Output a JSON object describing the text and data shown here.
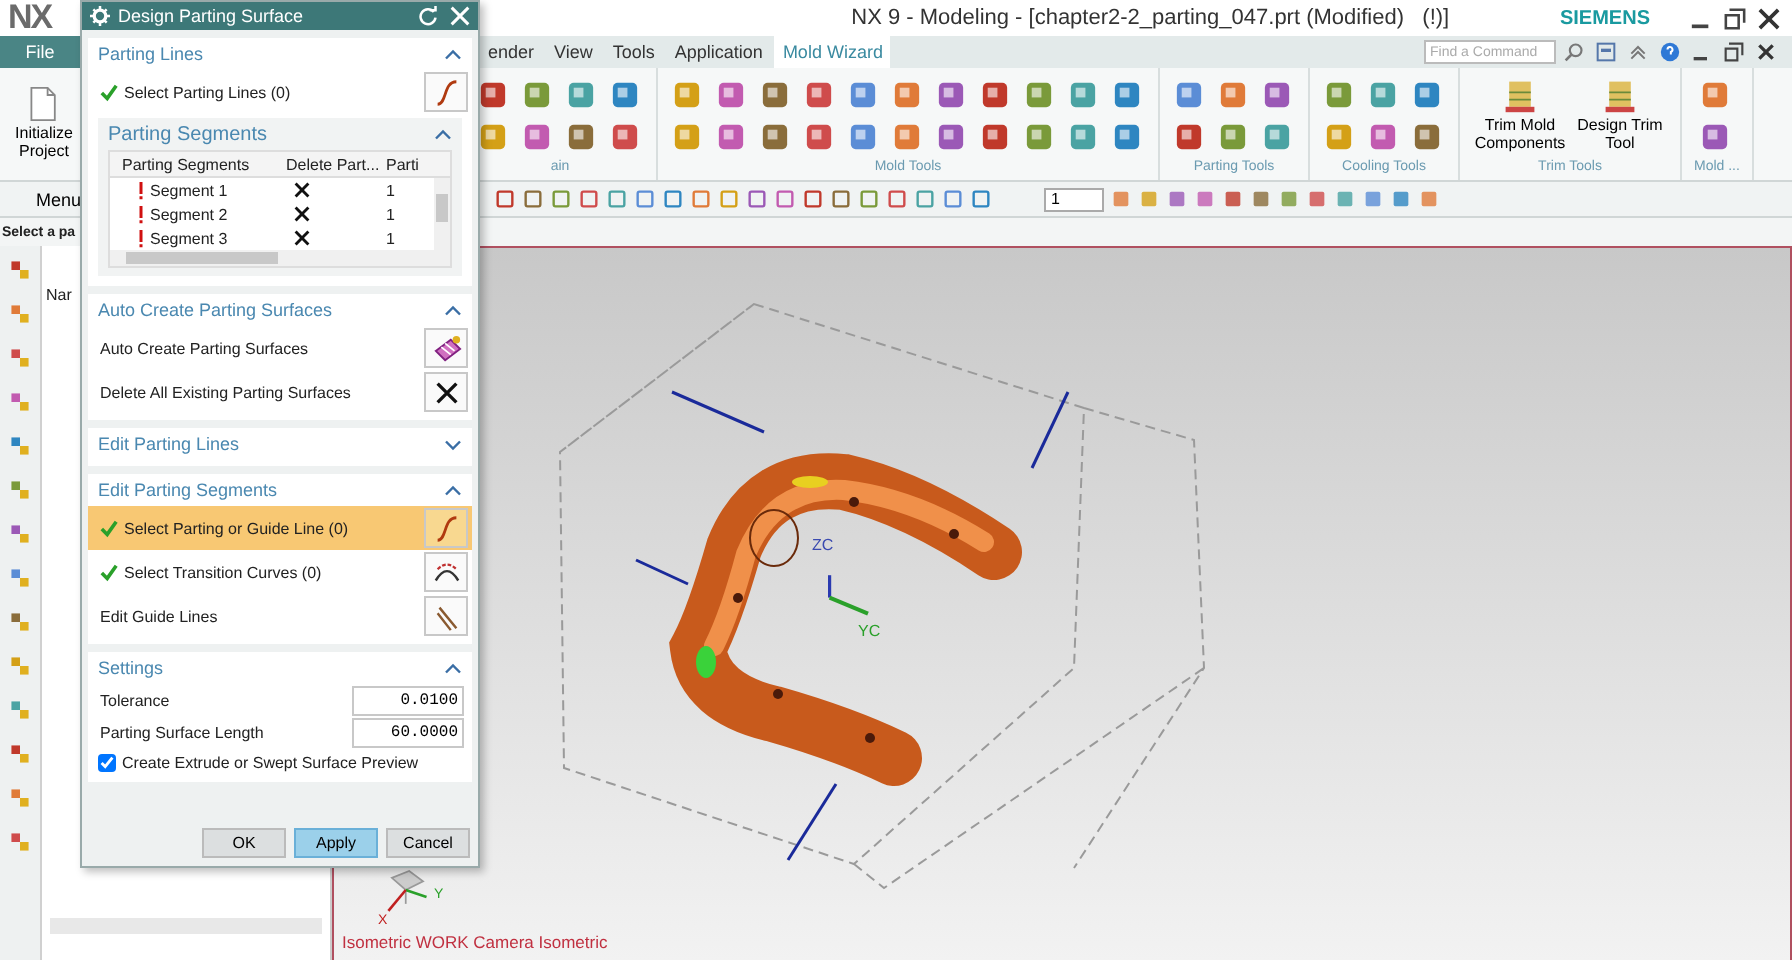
{
  "window": {
    "logo": "NX",
    "title": "NX 9 - Modeling - [chapter2-2_parting_047.prt (Modified)   (!)]",
    "brand": "SIEMENS"
  },
  "menu_tabs": [
    {
      "label": "File",
      "kind": "file",
      "selected": false
    },
    {
      "label": "ender",
      "kind": "tab",
      "selected": false
    },
    {
      "label": "View",
      "kind": "tab",
      "selected": false
    },
    {
      "label": "Tools",
      "kind": "tab",
      "selected": false
    },
    {
      "label": "Application",
      "kind": "tab",
      "selected": false
    },
    {
      "label": "Mold Wizard",
      "kind": "tab",
      "selected": true
    }
  ],
  "command_search": {
    "placeholder": "Find a Command"
  },
  "ribbon": {
    "initialize": "Initialize Project",
    "groups": [
      {
        "label": "ain"
      },
      {
        "label": "Mold Tools"
      },
      {
        "label": "Parting Tools"
      },
      {
        "label": "Cooling Tools"
      },
      {
        "label": "Trim Tools",
        "buttons": [
          "Trim Mold Components",
          "Design Trim Tool"
        ]
      },
      {
        "label": "Mold ..."
      }
    ]
  },
  "view_toolbar": {
    "menu": "Menu",
    "layer": "1"
  },
  "left_panel": {
    "selection_filter": "Select a pa",
    "navigator_column": "Nar"
  },
  "dialog": {
    "title": "Design Parting Surface",
    "sections": [
      {
        "title": "Parting Lines",
        "expanded": true,
        "rows": [
          {
            "label": "Select Parting Lines (0)",
            "kind": "curve",
            "complete": true,
            "active": false
          }
        ],
        "subsection": {
          "title": "Parting Segments",
          "expanded": true,
          "columns": [
            "Parting Segments",
            "Delete Part...",
            "Parti"
          ],
          "rows": [
            {
              "name": "Segment 1",
              "column_3": "1"
            },
            {
              "name": "Segment 2",
              "column_3": "1"
            },
            {
              "name": "Segment 3",
              "column_3": "1"
            }
          ]
        }
      },
      {
        "title": "Auto Create Parting Surfaces",
        "expanded": true,
        "rows": [
          {
            "label": "Auto Create Parting Surfaces",
            "kind": "surfaces",
            "complete": false,
            "active": false
          },
          {
            "label": "Delete All Existing Parting Surfaces",
            "kind": "delete",
            "complete": false,
            "active": false
          }
        ]
      },
      {
        "title": "Edit Parting Lines",
        "expanded": false
      },
      {
        "title": "Edit Parting Segments",
        "expanded": true,
        "rows": [
          {
            "label": "Select Parting or Guide Line (0)",
            "kind": "curve",
            "complete": true,
            "active": true
          },
          {
            "label": "Select Transition Curves (0)",
            "kind": "transition",
            "complete": true,
            "active": false
          },
          {
            "label": "Edit Guide Lines",
            "kind": "guide",
            "complete": false,
            "active": false
          }
        ]
      },
      {
        "title": "Settings",
        "expanded": true,
        "fields": [
          {
            "label": "Tolerance",
            "value": "0.0100"
          },
          {
            "label": "Parting Surface Length",
            "value": "60.0000"
          }
        ],
        "checkbox": {
          "label": "Create Extrude or Swept Surface Preview",
          "checked": true
        }
      }
    ],
    "buttons": [
      {
        "label": "OK",
        "default": false
      },
      {
        "label": "Apply",
        "default": true
      },
      {
        "label": "Cancel",
        "default": false
      }
    ]
  },
  "viewport": {
    "axes": [
      "ZC",
      "YC"
    ],
    "triad_labels": [
      "Y",
      "X"
    ],
    "view_label": "Isometric WORK Camera Isometric"
  }
}
